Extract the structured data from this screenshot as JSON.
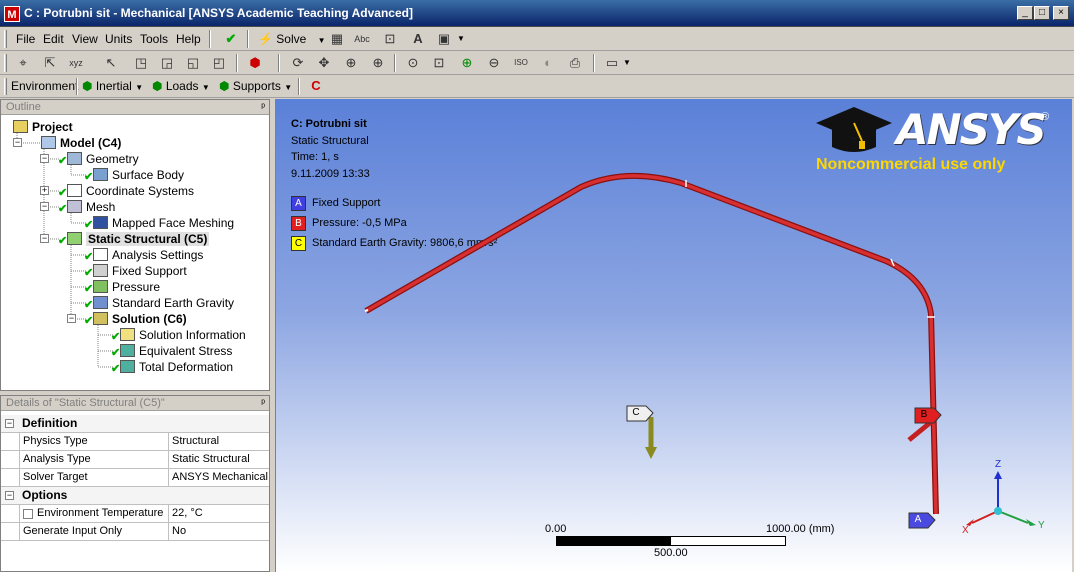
{
  "window": {
    "title": "C : Potrubni sit - Mechanical [ANSYS Academic Teaching Advanced]",
    "icon_letter": "M",
    "min_glyph": "_",
    "max_glyph": "□",
    "close_glyph": "×"
  },
  "menubar": {
    "items": [
      "File",
      "Edit",
      "View",
      "Units",
      "Tools",
      "Help"
    ],
    "solve_label": "Solve"
  },
  "context_toolbar": {
    "environment": "Environment",
    "inertial": "Inertial",
    "loads": "Loads",
    "supports": "Supports"
  },
  "outline": {
    "title": "Outline",
    "pin": "ᵖ",
    "nodes": [
      {
        "label": "Project",
        "bold": true
      },
      {
        "label": "Model (C4)",
        "bold": true
      },
      {
        "label": "Geometry"
      },
      {
        "label": "Surface Body"
      },
      {
        "label": "Coordinate Systems"
      },
      {
        "label": "Mesh"
      },
      {
        "label": "Mapped Face Meshing"
      },
      {
        "label": "Static Structural (C5)",
        "bold": true
      },
      {
        "label": "Analysis Settings"
      },
      {
        "label": "Fixed Support"
      },
      {
        "label": "Pressure"
      },
      {
        "label": "Standard Earth Gravity"
      },
      {
        "label": "Solution (C6)",
        "bold": true
      },
      {
        "label": "Solution Information"
      },
      {
        "label": "Equivalent Stress"
      },
      {
        "label": "Total Deformation"
      }
    ]
  },
  "details": {
    "title": "Details of \"Static Structural (C5)\"",
    "groups": [
      {
        "name": "Definition",
        "rows": [
          {
            "key": "Physics Type",
            "value": "Structural"
          },
          {
            "key": "Analysis Type",
            "value": "Static Structural"
          },
          {
            "key": "Solver Target",
            "value": "ANSYS Mechanical"
          }
        ]
      },
      {
        "name": "Options",
        "rows": [
          {
            "key": "Environment Temperature",
            "value": "22, °C"
          },
          {
            "key": "Generate Input Only",
            "value": "No"
          }
        ]
      }
    ]
  },
  "viewport": {
    "info_title": "C: Potrubni sit",
    "info_type": "Static Structural",
    "info_time": "Time: 1, s",
    "info_date": "9.11.2009 13:33",
    "legend": [
      {
        "letter": "A",
        "label": "Fixed Support",
        "color": "#4040e0"
      },
      {
        "letter": "B",
        "label": "Pressure: -0,5 MPa",
        "color": "#e02020"
      },
      {
        "letter": "C",
        "label": "Standard Earth Gravity: 9806,6 mm/s²",
        "color": "#ffff00"
      }
    ],
    "logo_text": "ANSYS",
    "logo_mark": "®",
    "noncommercial": "Noncommercial use only",
    "scale_left": "0.00",
    "scale_right": "1000.00 (mm)",
    "scale_mid": "500.00",
    "markers": {
      "a": "A",
      "b": "B",
      "c": "C"
    },
    "axes": {
      "x": "X",
      "y": "Y",
      "z": "Z"
    },
    "pipe_color": "#c42828"
  }
}
